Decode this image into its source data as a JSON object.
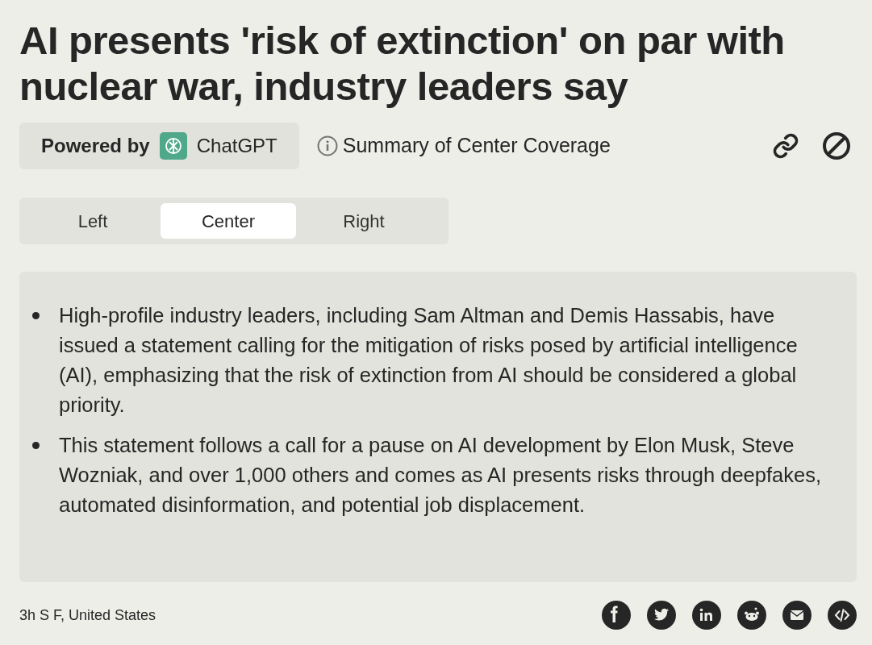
{
  "headline": "AI presents 'risk of extinction' on par with nuclear war, industry leaders say",
  "powered_by": {
    "label": "Powered by",
    "brand": "ChatGPT"
  },
  "summary_label": "Summary of Center Coverage",
  "tabs": [
    {
      "label": "Left",
      "selected": false
    },
    {
      "label": "Center",
      "selected": true
    },
    {
      "label": "Right",
      "selected": false
    }
  ],
  "bullets": [
    "High-profile industry leaders, including Sam Altman and Demis Hassabis, have issued a statement calling for the mitigation of risks posed by artificial intelligence (AI), emphasizing that the risk of extinction from AI should be considered a global priority.",
    "This statement follows a call for a pause on AI development by Elon Musk, Steve Wozniak, and over 1,000 others and comes as AI presents risks through deepfakes, automated disinformation, and potential job displacement."
  ],
  "footer": {
    "meta": "3h S F, United States",
    "share": [
      {
        "kind": "facebook"
      },
      {
        "kind": "twitter"
      },
      {
        "kind": "linkedin"
      },
      {
        "kind": "reddit"
      },
      {
        "kind": "email"
      },
      {
        "kind": "embed"
      }
    ]
  }
}
